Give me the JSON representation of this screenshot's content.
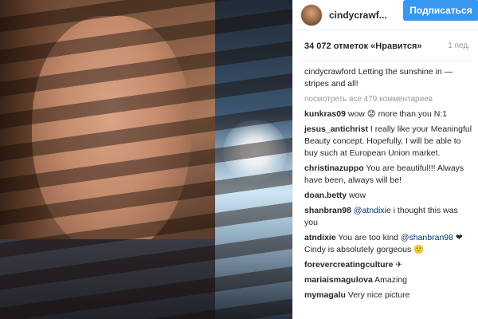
{
  "post": {
    "photo_alt": "selfie in sunlight through window blinds"
  },
  "header": {
    "username": "cindycrawf...",
    "follow_label": "Подписаться"
  },
  "stats": {
    "likes": "34 072 отметок «Нравится»",
    "time": "1 пед."
  },
  "caption": {
    "user": "cindycrawford",
    "text": "Letting the sunshine in — stripes and all!"
  },
  "view_all": "посмотреть все 479 комментариев",
  "comments": [
    {
      "user": "kunkras09",
      "text": "wow 😟 more than.you N:1",
      "mention": ""
    },
    {
      "user": "jesus_antichrist",
      "text": "I really like your Meaningful Beauty concept. Hopefully, I will be able to buy such at European Union market.",
      "mention": ""
    },
    {
      "user": "christinazuppo",
      "text": "You are beautiful!!! Always have been, always will be!",
      "mention": ""
    },
    {
      "user": "doan.betty",
      "text": "wow",
      "mention": ""
    },
    {
      "user": "shanbran98",
      "mention": "@atndixie",
      "text": " i thought this was you"
    },
    {
      "user": "atndixie",
      "text": "You are too kind ",
      "mention": "@shanbran98",
      "text2": "❤ Cindy is absolutely gorgeous 🙂"
    },
    {
      "user": "forevercreatingculture",
      "text": "✈",
      "mention": ""
    },
    {
      "user": "mariaismagulova",
      "text": "Amazing",
      "mention": ""
    },
    {
      "user": "mymagalu",
      "text": "Very nice picture",
      "mention": ""
    }
  ]
}
